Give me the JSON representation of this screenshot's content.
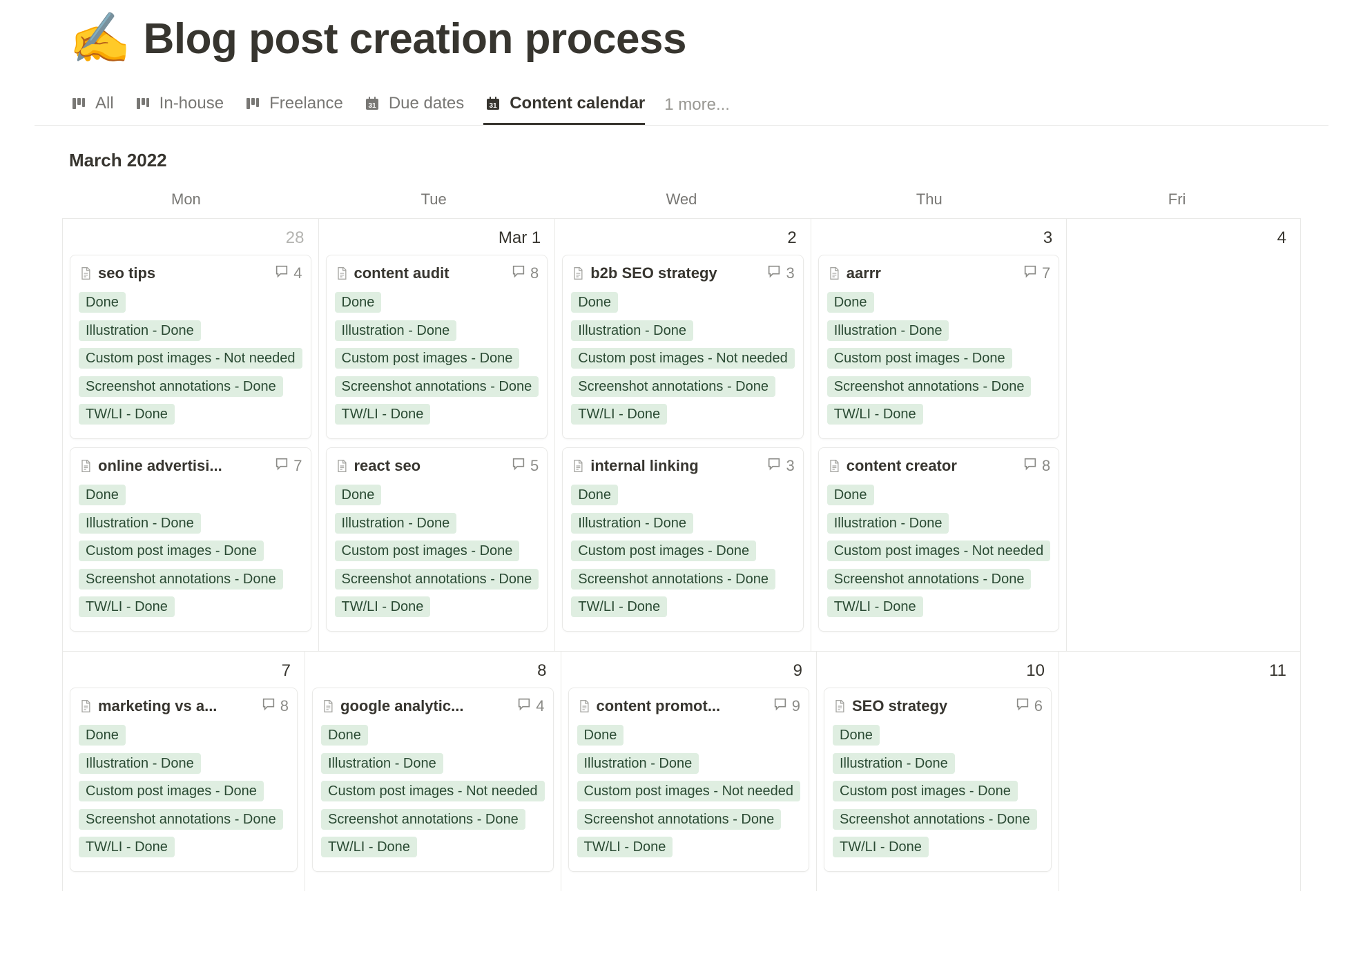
{
  "header": {
    "icon": "✍️",
    "title": "Blog post creation process"
  },
  "tabs": [
    {
      "label": "All",
      "icon": "board",
      "active": false
    },
    {
      "label": "In-house",
      "icon": "board",
      "active": false
    },
    {
      "label": "Freelance",
      "icon": "board",
      "active": false
    },
    {
      "label": "Due dates",
      "icon": "calendar",
      "active": false
    },
    {
      "label": "Content calendar",
      "icon": "calendar",
      "active": true
    }
  ],
  "tabs_more": "1 more...",
  "month": "March 2022",
  "weekdays": [
    "Mon",
    "Tue",
    "Wed",
    "Thu",
    "Fri"
  ],
  "weeks": [
    {
      "days": [
        {
          "label": "28",
          "dim": true,
          "cards": [
            {
              "title": "seo tips",
              "comments": 4,
              "tags": [
                "Done",
                "Illustration - Done",
                "Custom post images - Not needed",
                "Screenshot annotations - Done",
                "TW/LI - Done"
              ]
            },
            {
              "title": "online advertisi...",
              "comments": 7,
              "tags": [
                "Done",
                "Illustration - Done",
                "Custom post images - Done",
                "Screenshot annotations - Done",
                "TW/LI - Done"
              ]
            }
          ]
        },
        {
          "label": "Mar 1",
          "dim": false,
          "cards": [
            {
              "title": "content audit",
              "comments": 8,
              "tags": [
                "Done",
                "Illustration - Done",
                "Custom post images - Done",
                "Screenshot annotations - Done",
                "TW/LI - Done"
              ]
            },
            {
              "title": "react seo",
              "comments": 5,
              "tags": [
                "Done",
                "Illustration - Done",
                "Custom post images - Done",
                "Screenshot annotations - Done",
                "TW/LI - Done"
              ]
            }
          ]
        },
        {
          "label": "2",
          "dim": false,
          "cards": [
            {
              "title": "b2b SEO strategy",
              "comments": 3,
              "tags": [
                "Done",
                "Illustration - Done",
                "Custom post images - Not needed",
                "Screenshot annotations - Done",
                "TW/LI - Done"
              ]
            },
            {
              "title": "internal linking",
              "comments": 3,
              "tags": [
                "Done",
                "Illustration - Done",
                "Custom post images - Done",
                "Screenshot annotations - Done",
                "TW/LI - Done"
              ]
            }
          ]
        },
        {
          "label": "3",
          "dim": false,
          "cards": [
            {
              "title": "aarrr",
              "comments": 7,
              "tags": [
                "Done",
                "Illustration - Done",
                "Custom post images - Done",
                "Screenshot annotations - Done",
                "TW/LI - Done"
              ]
            },
            {
              "title": "content creator",
              "comments": 8,
              "tags": [
                "Done",
                "Illustration - Done",
                "Custom post images - Not needed",
                "Screenshot annotations - Done",
                "TW/LI - Done"
              ]
            }
          ]
        },
        {
          "label": "4",
          "dim": false,
          "cards": []
        }
      ]
    },
    {
      "days": [
        {
          "label": "7",
          "dim": false,
          "cards": [
            {
              "title": "marketing vs a...",
              "comments": 8,
              "tags": [
                "Done",
                "Illustration - Done",
                "Custom post images - Done",
                "Screenshot annotations - Done",
                "TW/LI - Done"
              ]
            }
          ]
        },
        {
          "label": "8",
          "dim": false,
          "cards": [
            {
              "title": "google analytic...",
              "comments": 4,
              "tags": [
                "Done",
                "Illustration - Done",
                "Custom post images - Not needed",
                "Screenshot annotations - Done",
                "TW/LI - Done"
              ]
            }
          ]
        },
        {
          "label": "9",
          "dim": false,
          "cards": [
            {
              "title": "content promot...",
              "comments": 9,
              "tags": [
                "Done",
                "Illustration - Done",
                "Custom post images - Not needed",
                "Screenshot annotations - Done",
                "TW/LI - Done"
              ]
            }
          ]
        },
        {
          "label": "10",
          "dim": false,
          "cards": [
            {
              "title": "SEO strategy",
              "comments": 6,
              "tags": [
                "Done",
                "Illustration - Done",
                "Custom post images - Done",
                "Screenshot annotations - Done",
                "TW/LI - Done"
              ]
            }
          ]
        },
        {
          "label": "11",
          "dim": false,
          "cards": []
        }
      ]
    }
  ]
}
